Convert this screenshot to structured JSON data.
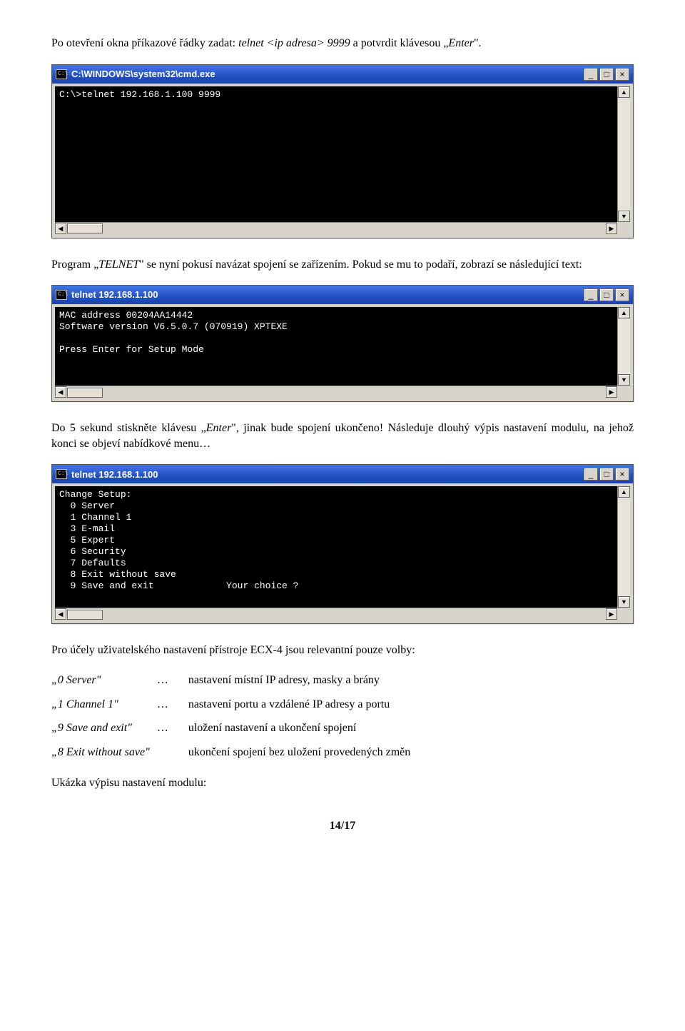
{
  "para1_a": "Po otevření okna příkazové řádky zadat: ",
  "para1_cmd": "telnet <ip adresa> 9999",
  "para1_b": " a potvrdit klávesou „",
  "para1_enter": "Enter",
  "para1_c": "\".",
  "win1": {
    "title": "C:\\WINDOWS\\system32\\cmd.exe",
    "body": "C:\\>telnet 192.168.1.100 9999"
  },
  "para2_a": "Program „",
  "para2_telnet": "TELNET",
  "para2_b": "\" se nyní pokusí navázat spojení se zařízením. Pokud se mu to podaří, zobrazí se následující text:",
  "win2": {
    "title": "telnet 192.168.1.100",
    "body": "MAC address 00204AA14442\nSoftware version V6.5.0.7 (070919) XPTEXE\n\nPress Enter for Setup Mode"
  },
  "para3_a": "Do 5 sekund stiskněte klávesu „",
  "para3_enter": "Enter",
  "para3_b": "\", jinak bude spojení ukončeno! Následuje dlouhý výpis nastavení modulu, na jehož konci se objeví nabídkové menu…",
  "win3": {
    "title": "telnet 192.168.1.100",
    "body": "Change Setup:\n  0 Server\n  1 Channel 1\n  3 E-mail\n  5 Expert\n  6 Security\n  7 Defaults\n  8 Exit without save\n  9 Save and exit             Your choice ?"
  },
  "para4": "Pro účely uživatelského nastavení přístroje ECX-4 jsou relevantní pouze volby:",
  "options": [
    {
      "label": "„0  Server\"",
      "dots": "…",
      "desc": "nastavení místní IP adresy, masky a brány"
    },
    {
      "label": "„1  Channel 1\"",
      "dots": "…",
      "desc": "nastavení portu a vzdálené IP adresy a portu"
    },
    {
      "label": "„9  Save and exit\"",
      "dots": "…",
      "desc": "uložení nastavení a ukončení spojení"
    },
    {
      "label": " „8  Exit without save\"",
      "dots": "",
      "desc": "ukončení spojení bez uložení provedených změn"
    }
  ],
  "para5": "Ukázka výpisu nastavení modulu:",
  "page_number": "14/17",
  "ui": {
    "min": "_",
    "max": "□",
    "close": "×",
    "up": "▲",
    "down": "▼",
    "left": "◀",
    "right": "▶",
    "appicon": "C:\\"
  }
}
